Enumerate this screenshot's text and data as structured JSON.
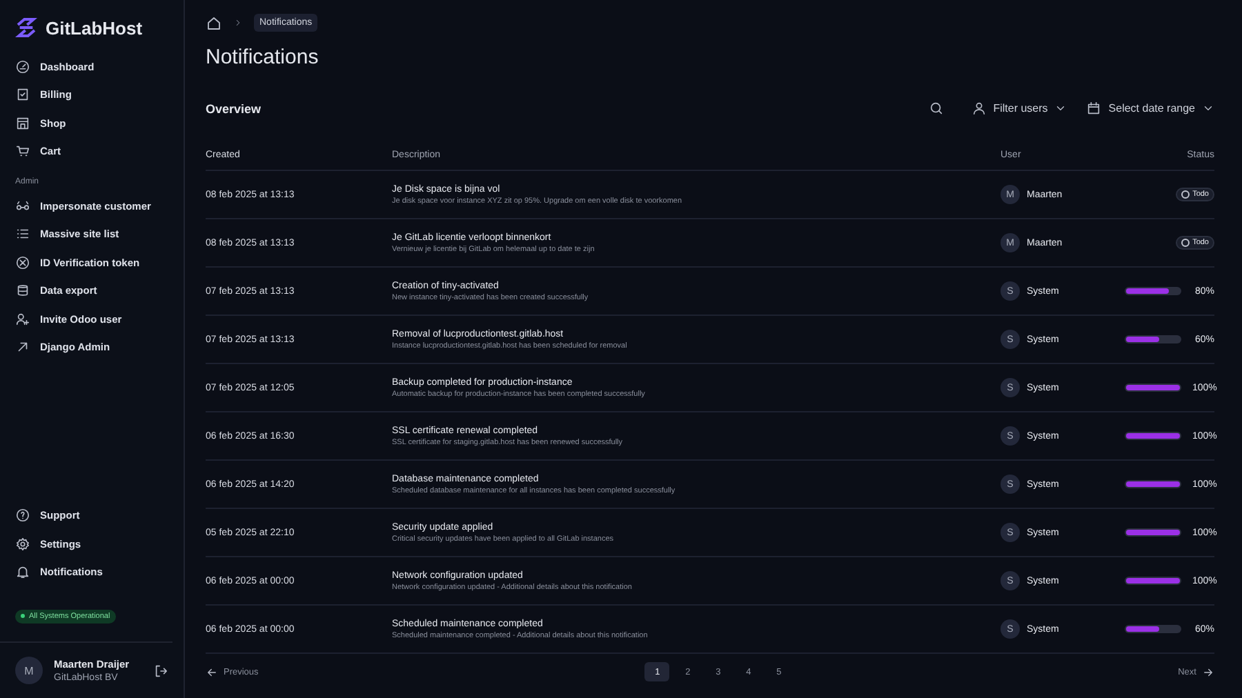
{
  "brand": "GitLabHost",
  "nav": [
    "Dashboard",
    "Billing",
    "Shop",
    "Cart"
  ],
  "admin_heading": "Admin",
  "admin_nav": [
    "Impersonate customer",
    "Massive site list",
    "ID Verification token",
    "Data export",
    "Invite Odoo user",
    "Django Admin"
  ],
  "bottom_nav": [
    "Support",
    "Settings",
    "Notifications"
  ],
  "system_status": "All Systems Operational",
  "account": {
    "avatar": "M",
    "name": "Maarten Draijer",
    "company": "GitLabHost BV"
  },
  "breadcrumb": "Notifications",
  "title": "Notifications",
  "section": "Overview",
  "filters": {
    "users": "Filter users",
    "date": "Select date range"
  },
  "columns": [
    "Created",
    "Description",
    "User",
    "Status"
  ],
  "rows": [
    {
      "created": "08 feb 2025 at 13:13",
      "title": "Je Disk space is bijna vol",
      "detail": "Je disk space voor instance XYZ zit op 95%. Upgrade om een volle disk te voorkomen",
      "avatar": "M",
      "user": "Maarten",
      "kind": "todo",
      "status": "Todo"
    },
    {
      "created": "08 feb 2025 at 13:13",
      "title": "Je GitLab licentie verloopt binnenkort",
      "detail": "Vernieuw je licentie bij GitLab om helemaal up to date te zijn",
      "avatar": "M",
      "user": "Maarten",
      "kind": "todo",
      "status": "Todo"
    },
    {
      "created": "07 feb 2025 at 13:13",
      "title": "Creation of tiny-activated",
      "detail": "New instance tiny-activated has been created successfully",
      "avatar": "S",
      "user": "System",
      "kind": "progress",
      "level": 0.8,
      "status": "80%"
    },
    {
      "created": "07 feb 2025 at 13:13",
      "title": "Removal of lucproductiontest.gitlab.host",
      "detail": "Instance lucproductiontest.gitlab.host has been scheduled for removal",
      "avatar": "S",
      "user": "System",
      "kind": "progress",
      "level": 0.6,
      "status": "60%"
    },
    {
      "created": "07 feb 2025 at 12:05",
      "title": "Backup completed for production-instance",
      "detail": "Automatic backup for production-instance has been completed successfully",
      "avatar": "S",
      "user": "System",
      "kind": "progress",
      "level": 1,
      "status": "100%"
    },
    {
      "created": "06 feb 2025 at 16:30",
      "title": "SSL certificate renewal completed",
      "detail": "SSL certificate for staging.gitlab.host has been renewed successfully",
      "avatar": "S",
      "user": "System",
      "kind": "progress",
      "level": 1,
      "status": "100%"
    },
    {
      "created": "06 feb 2025 at 14:20",
      "title": "Database maintenance completed",
      "detail": "Scheduled database maintenance for all instances has been completed successfully",
      "avatar": "S",
      "user": "System",
      "kind": "progress",
      "level": 1,
      "status": "100%"
    },
    {
      "created": "05 feb 2025 at 22:10",
      "title": "Security update applied",
      "detail": "Critical security updates have been applied to all GitLab instances",
      "avatar": "S",
      "user": "System",
      "kind": "progress",
      "level": 1,
      "status": "100%"
    },
    {
      "created": "06 feb 2025 at 00:00",
      "title": "Network configuration updated",
      "detail": "Network configuration updated - Additional details about this notification",
      "avatar": "S",
      "user": "System",
      "kind": "progress",
      "level": 1,
      "status": "100%"
    },
    {
      "created": "06 feb 2025 at 00:00",
      "title": "Scheduled maintenance completed",
      "detail": "Scheduled maintenance completed - Additional details about this notification",
      "avatar": "S",
      "user": "System",
      "kind": "progress",
      "level": 0.6,
      "status": "60%"
    }
  ],
  "pagination": {
    "previous": "Previous",
    "next": "Next",
    "pages": [
      {
        "label": "1",
        "selected": true
      },
      {
        "label": "2",
        "selected": false
      },
      {
        "label": "3",
        "selected": false
      },
      {
        "label": "4",
        "selected": false
      },
      {
        "label": "5",
        "selected": false
      }
    ]
  }
}
